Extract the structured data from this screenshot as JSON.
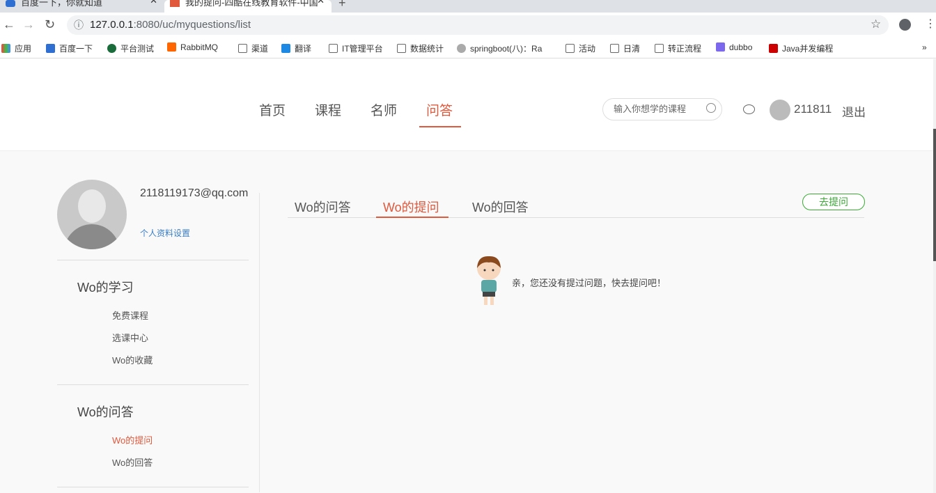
{
  "browser": {
    "tabs": [
      {
        "title": "百度一下，你就知道"
      },
      {
        "title": "我的提问-四酷在线教育软件-中国"
      }
    ],
    "url_host": "127.0.0.1",
    "url_path": ":8080/uc/myquestions/list",
    "bookmarks": [
      "应用",
      "百度一下",
      "平台测试",
      "RabbitMQ",
      "渠道",
      "翻译",
      "IT管理平台",
      "数据统计",
      "springboot(八)：Ra",
      "活动",
      "日清",
      "转正流程",
      "dubbo",
      "Java并发编程"
    ],
    "more": "»"
  },
  "header": {
    "nav": [
      "首页",
      "课程",
      "名师",
      "问答"
    ],
    "search_placeholder": "输入你想学的课程",
    "username": "211811",
    "logout": "退出"
  },
  "profile": {
    "email": "2118119173@qq.com",
    "settings": "个人资料设置"
  },
  "sidebar": {
    "sections": [
      {
        "title": "Wo的学习",
        "items": [
          "免费课程",
          "选课中心",
          "Wo的收藏"
        ]
      },
      {
        "title": "Wo的问答",
        "items": [
          "Wo的提问",
          "Wo的回答"
        ]
      }
    ]
  },
  "main": {
    "tabs": [
      "Wo的问答",
      "Wo的提问",
      "Wo的回答"
    ],
    "ask_button": "去提问",
    "empty_message": "亲，您还没有提过问题，快去提问吧！"
  },
  "colors": {
    "accent": "#e0593c",
    "green": "#3aaa35"
  }
}
